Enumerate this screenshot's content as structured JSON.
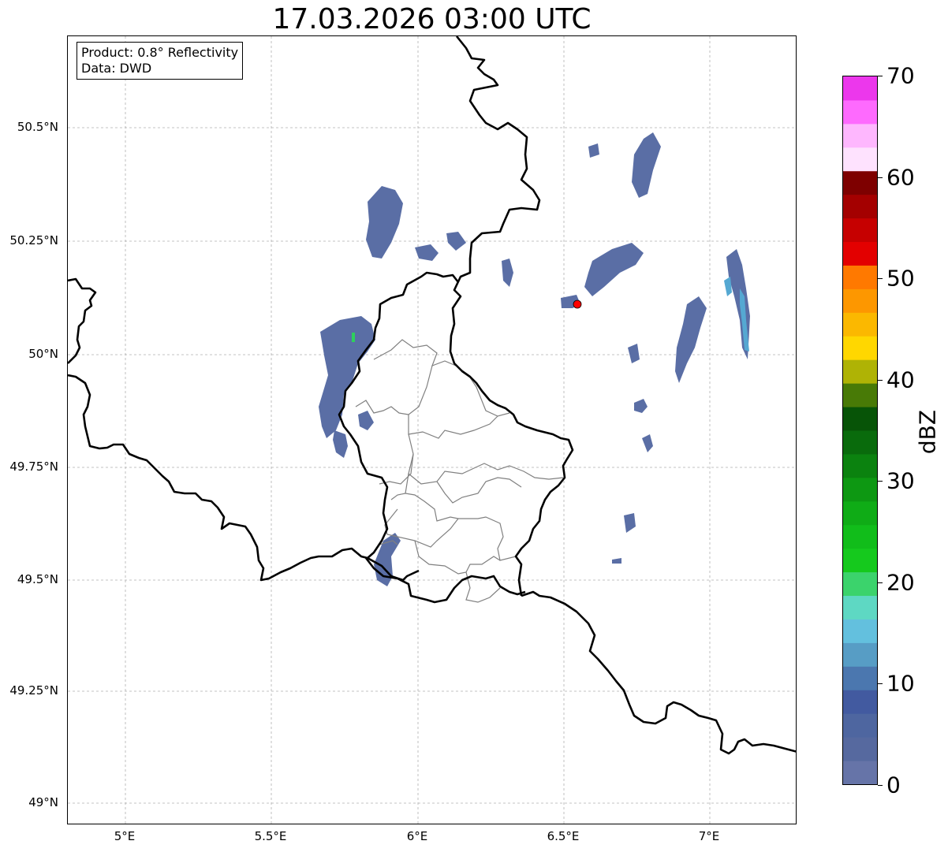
{
  "title": "17.03.2026 03:00 UTC",
  "info_box": {
    "product": "Product: 0.8° Reflectivity",
    "data": "Data: DWD"
  },
  "map": {
    "x_ticks": [
      "5°E",
      "5.5°E",
      "6°E",
      "6.5°E",
      "7°E"
    ],
    "y_ticks": [
      "50.5°N",
      "50.25°N",
      "50°N",
      "49.75°N",
      "49.5°N",
      "49.25°N",
      "49°N"
    ],
    "extent": {
      "lon": [
        4.8,
        7.3
      ],
      "lat": [
        48.95,
        50.7
      ]
    },
    "gridlines": true,
    "radar_site": {
      "lon": 6.548,
      "lat": 50.11,
      "color": "#ff0000"
    }
  },
  "colorbar": {
    "label": "dBZ",
    "ticks": [
      "0",
      "10",
      "20",
      "30",
      "40",
      "50",
      "60",
      "70"
    ],
    "range": [
      0,
      70
    ],
    "colors": [
      "#6674a8",
      "#56699f",
      "#4e66a0",
      "#425aa0",
      "#4b77af",
      "#579dc5",
      "#63c0de",
      "#5ed8c3",
      "#3bd36c",
      "#15c91d",
      "#11bd1a",
      "#0fac16",
      "#0d9812",
      "#0b820f",
      "#096b0c",
      "#075407",
      "#487a06",
      "#afb305",
      "#ffd700",
      "#fbb800",
      "#fd9700",
      "#ff7900",
      "#e30000",
      "#c60000",
      "#a40000",
      "#7e0000",
      "#fee2fe",
      "#feb7fe",
      "#fe6afe",
      "#ec37ec"
    ]
  },
  "colors": {
    "echo_main": "#5a6ea5",
    "echo_light": "#55a8d2",
    "echo_green": "#2ed15b",
    "border": "#000000",
    "admin_border": "#808080"
  }
}
